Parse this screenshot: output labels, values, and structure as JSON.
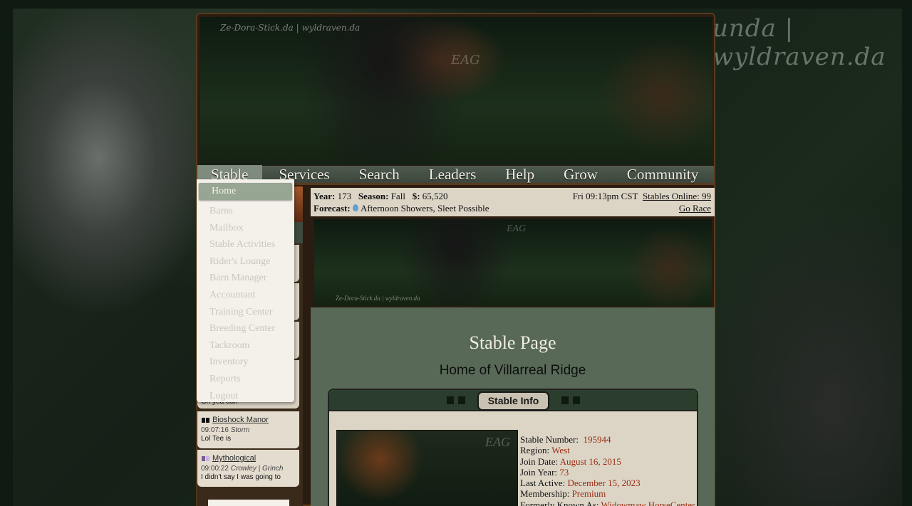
{
  "background": {
    "watermark": "unda | wyldraven.da"
  },
  "banner": {
    "signature": "Ze-Dora-Stick.da | wyldraven.da",
    "logo": "EAG"
  },
  "nav": {
    "items": [
      {
        "label": "Stable"
      },
      {
        "label": "Services"
      },
      {
        "label": "Search"
      },
      {
        "label": "Leaders"
      },
      {
        "label": "Help"
      },
      {
        "label": "Grow"
      },
      {
        "label": "Community"
      }
    ],
    "active": "Stable"
  },
  "dropdown": {
    "items": [
      "Home",
      "Barns",
      "Mailbox",
      "Stable Activities",
      "Rider's Lounge",
      "Barn Manager",
      "Accountant",
      "Training Center",
      "Breeding Center",
      "Tackroom",
      "Inventory",
      "Reports",
      "Logout"
    ]
  },
  "status": {
    "year_label": "Year:",
    "year": "173",
    "season_label": "Season:",
    "season": "Fall",
    "money_label": "$:",
    "money": "65,520",
    "forecast_label": "Forecast:",
    "forecast": "Afternoon Showers, Sleet Possible",
    "time": "Fri 09:13pm CST",
    "stables_online": "Stables Online: 99",
    "go_race": "Go Race"
  },
  "chat": {
    "partial_msg": "Oh yea duh",
    "entries": [
      {
        "name": "Bioshock Manor",
        "time": "09:07:16",
        "user": "Storm",
        "msg": "Lol Tee is",
        "flag_colors": [
          "#111111",
          "#111111"
        ]
      },
      {
        "name": "Mythological",
        "time": "09:00:22",
        "user": "Crowley | Grinch",
        "msg": "I didn't say I was going to",
        "flag_colors": [
          "#7a5a9a",
          "#c9b6dc"
        ]
      }
    ]
  },
  "mini_banner": {
    "signature": "Ze-Dora-Stick.da | wyldraven.da",
    "logo": "EAG"
  },
  "content": {
    "title": "Stable Page",
    "subtitle": "Home of Villarreal Ridge",
    "panel_tab": "Stable Info",
    "photo_logo": "EAG",
    "info": [
      {
        "label": "Stable Number:",
        "value": "195944"
      },
      {
        "label": "Region:",
        "value": "West"
      },
      {
        "label": "Join Date:",
        "value": "August 16, 2015"
      },
      {
        "label": "Join Year:",
        "value": "73"
      },
      {
        "label": "Last Active:",
        "value": "December 15, 2023"
      },
      {
        "label": "Membership:",
        "value": "Premium"
      },
      {
        "label": "Formerly Known As:",
        "value": "Widowmaw HorseCenter"
      }
    ]
  },
  "colors": {
    "nav_bg": "#4f5a4f",
    "nav_active": "#7f8b7c",
    "content_bg": "#586a57",
    "panel_bg": "#dcd5c6",
    "value_red": "#9a2c12"
  }
}
